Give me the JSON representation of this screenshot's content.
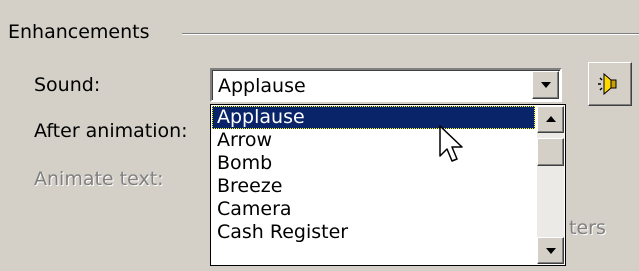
{
  "group": {
    "title": "Enhancements"
  },
  "labels": {
    "sound": "Sound:",
    "after_animation": "After animation:",
    "animate_text": "Animate text:",
    "partial_hidden": "ters"
  },
  "sound_combo": {
    "value": "Applause"
  },
  "dropdown": {
    "items": [
      "Applause",
      "Arrow",
      "Bomb",
      "Breeze",
      "Camera",
      "Cash Register"
    ],
    "selected_index": 0
  },
  "icons": {
    "combo_arrow": "chevron-down-icon",
    "play_sound": "speaker-icon",
    "scroll_up": "scroll-up-icon",
    "scroll_down": "scroll-down-icon",
    "cursor": "mouse-pointer-icon"
  },
  "colors": {
    "selection": "#0a246a",
    "face": "#d4d0c8"
  }
}
